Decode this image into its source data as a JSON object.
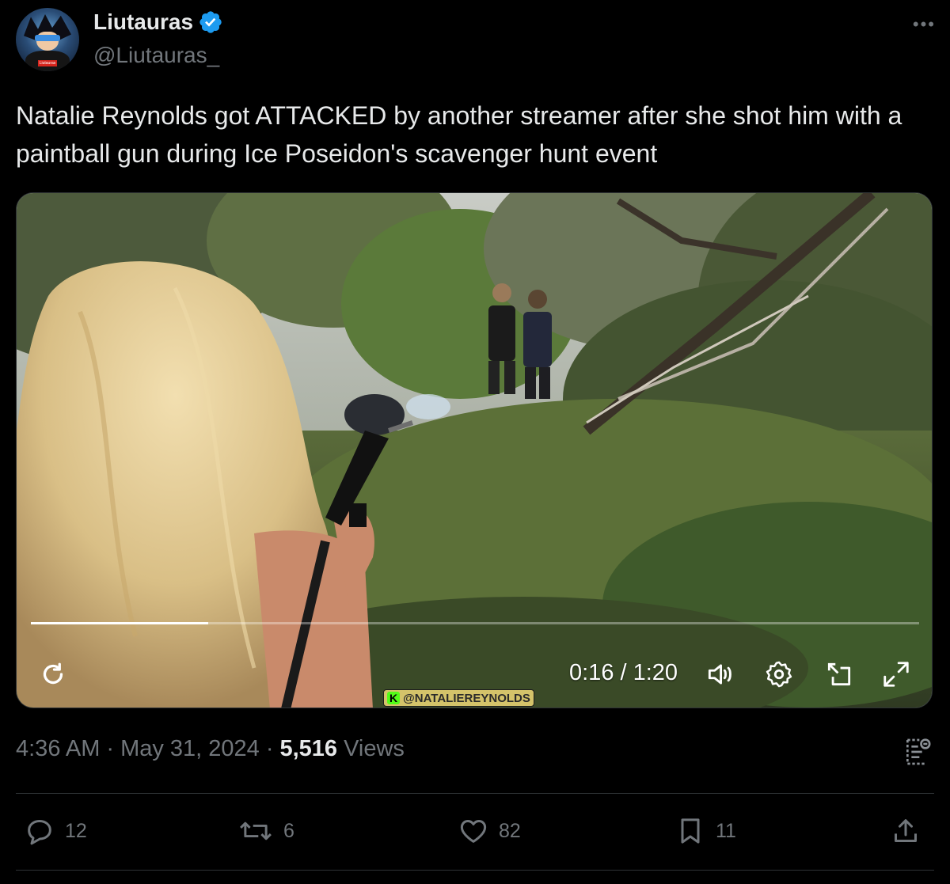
{
  "author": {
    "name": "Liutauras",
    "handle": "@Liutauras_",
    "avatar_tag": "Liutauras"
  },
  "tweet": {
    "text": "Natalie Reynolds got ATTACKED by another streamer after she shot him with a paintball gun during Ice Poseidon's scavenger hunt event"
  },
  "video": {
    "current_time": "0:16",
    "duration": "1:20",
    "time_display": "0:16 / 1:20",
    "progress": 0.2,
    "watermark": "@NATALIEREYNOLDS",
    "watermark_k": "K"
  },
  "meta": {
    "time": "4:36 AM",
    "sep1": "·",
    "date": "May 31, 2024",
    "sep2": "·",
    "views_count": "5,516",
    "views_label": "Views"
  },
  "actions": {
    "replies": "12",
    "reposts": "6",
    "likes": "82",
    "bookmarks": "11"
  },
  "colors": {
    "background": "#000000",
    "text_primary": "#e7e9ea",
    "text_secondary": "#71767b",
    "verified": "#1d9bf0",
    "divider": "#2f3336"
  },
  "icons": {
    "verified": "verified-badge-icon",
    "more": "more-dots-icon",
    "replay": "replay-icon",
    "volume": "volume-icon",
    "settings": "gear-icon",
    "pip": "picture-in-picture-icon",
    "fullscreen": "fullscreen-icon",
    "analytics": "analytics-icon",
    "reply": "reply-icon",
    "repost": "repost-icon",
    "like": "heart-icon",
    "bookmark": "bookmark-icon",
    "share": "share-icon"
  }
}
